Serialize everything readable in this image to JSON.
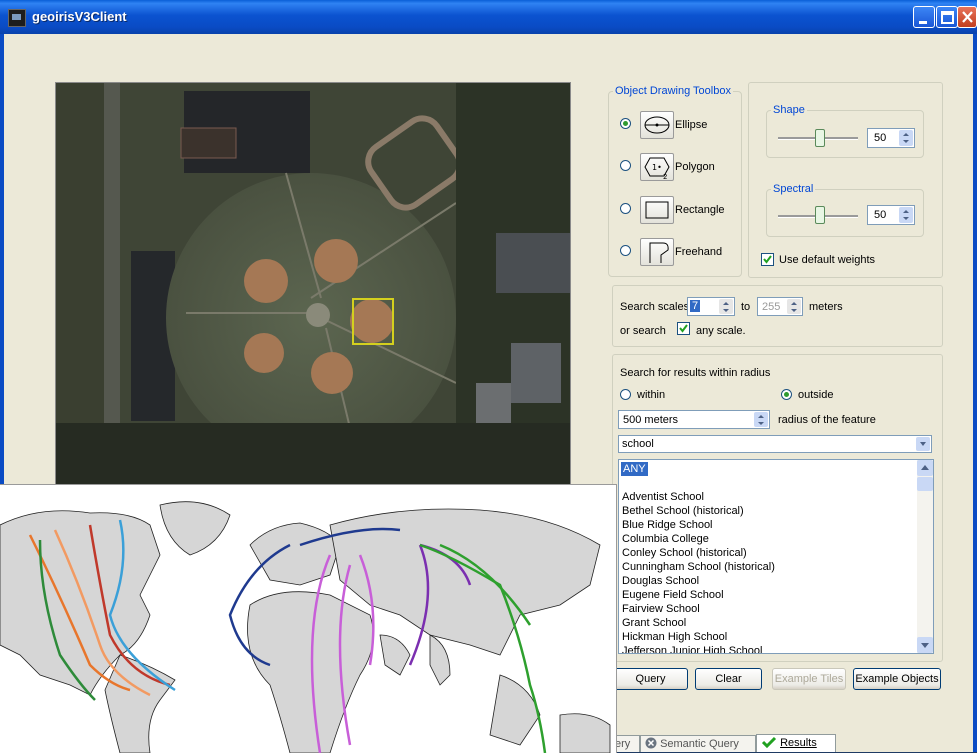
{
  "window": {
    "title": "geoirisV3Client"
  },
  "toolbox": {
    "legend": "Object Drawing Toolbox",
    "tools": [
      {
        "label": "Ellipse",
        "selected": true
      },
      {
        "label": "Polygon",
        "selected": false
      },
      {
        "label": "Rectangle",
        "selected": false
      },
      {
        "label": "Freehand",
        "selected": false
      }
    ]
  },
  "weights": {
    "shape_legend": "Shape",
    "shape_value": "50",
    "spectral_legend": "Spectral",
    "spectral_value": "50",
    "use_default_label": "Use default weights",
    "use_default_checked": true
  },
  "scales": {
    "search_scales_label": "Search scales",
    "from_value": "7",
    "to_label": "to",
    "to_value": "255",
    "meters_label": "meters",
    "or_search_label": "or search",
    "any_scale_label": "any scale.",
    "any_scale_checked": true
  },
  "radius": {
    "heading": "Search for results within radius",
    "within_label": "within",
    "outside_label": "outside",
    "selected": "outside",
    "distance_value": "500 meters",
    "radius_label": "radius of the feature",
    "feature_value": "school",
    "list_items": [
      "ANY",
      "Adventist School",
      "Bethel School (historical)",
      "Blue Ridge School",
      "Columbia College",
      "Conley School (historical)",
      "Cunningham School (historical)",
      "Douglas School",
      "Eugene Field School",
      "Fairview School",
      "Grant School",
      "Hickman High School",
      "Jefferson Junior High School"
    ]
  },
  "buttons": {
    "query": "Query",
    "clear": "Clear",
    "example_tiles": "Example Tiles",
    "example_objects": "Example Objects"
  },
  "tabs": [
    {
      "label": "ery",
      "active": false
    },
    {
      "label": "Semantic Query",
      "active": false
    },
    {
      "label": "Results",
      "active": true
    }
  ],
  "colors": {
    "title_bar": "#0a4bc4",
    "legend_text": "#0046d5",
    "selection": "#316ac5",
    "query_box": "#d4d01e",
    "route_colors": [
      "#e8762c",
      "#c0392b",
      "#2e8b3a",
      "#3ba0d8",
      "#1f3a8f",
      "#c85fd8",
      "#7b2fb0",
      "#2ea02e"
    ]
  }
}
